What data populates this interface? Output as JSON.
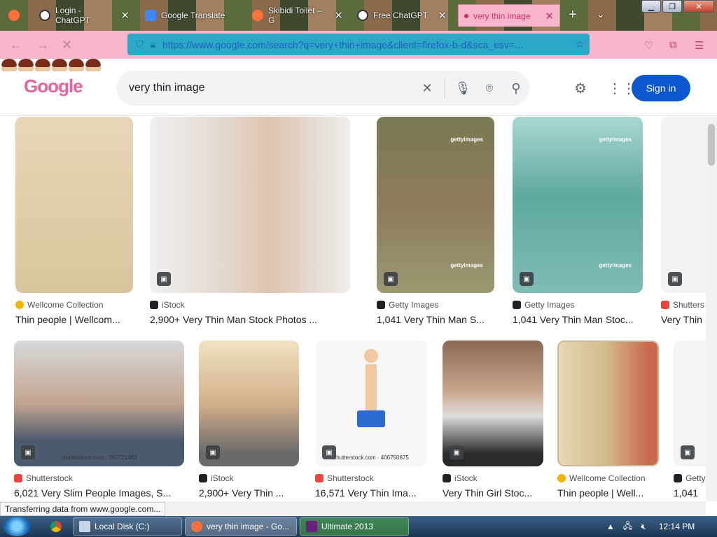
{
  "browser": {
    "tabs": [
      {
        "label": "Login - ChatGPT",
        "fav_color": "#ffffff"
      },
      {
        "label": "Google Translate",
        "fav_color": "#4285f4"
      },
      {
        "label": "Skibidi Toilet – G",
        "fav_color": "#ff7139"
      },
      {
        "label": "Free ChatGPT",
        "fav_color": "#ffffff"
      },
      {
        "label": "very thin image",
        "fav_color": "#d0305a"
      }
    ],
    "new_tab_symbol": "+",
    "url": "https://www.google.com/search?q=very+thin+image&client=firefox-b-d&sca_esv=..."
  },
  "google": {
    "logo_text": "Google",
    "query": "very thin image",
    "signin_label": "Sign in"
  },
  "results": {
    "row1": [
      {
        "source": "Wellcome Collection",
        "title": "Thin people | Wellcom...",
        "fav": "#f4b400"
      },
      {
        "source": "iStock",
        "title": "2,900+ Very Thin Man Stock Photos ...",
        "fav": "#202124"
      },
      {
        "source": "Getty Images",
        "title": "1,041 Very Thin Man S...",
        "fav": "#202124",
        "watermark": "gettyimages"
      },
      {
        "source": "Getty Images",
        "title": "1,041 Very Thin Man Stoc...",
        "fav": "#202124",
        "watermark": "gettyimages"
      },
      {
        "source": "Shutters",
        "title": "Very Thin",
        "fav": "#e8453c"
      }
    ],
    "row2": [
      {
        "source": "Shutterstock",
        "title": "6,021 Very Slim People Images, S...",
        "fav": "#e8453c",
        "watermark": "shutterstock.com · 367721483"
      },
      {
        "source": "iStock",
        "title": "2,900+ Very Thin ...",
        "fav": "#202124"
      },
      {
        "source": "Shutterstock",
        "title": "16,571 Very Thin Ima...",
        "fav": "#e8453c",
        "watermark": "shutterstock.com · 406750675"
      },
      {
        "source": "iStock",
        "title": "Very Thin Girl Stoc...",
        "fav": "#202124"
      },
      {
        "source": "Wellcome Collection",
        "title": "Thin people | Well...",
        "fav": "#f4b400"
      },
      {
        "source": "Getty",
        "title": "1,041",
        "fav": "#202124"
      }
    ]
  },
  "status_text": "Transferring data from www.google.com...",
  "taskbar": {
    "items": [
      {
        "label": "Local Disk (C:)"
      },
      {
        "label": "very thin image - Go..."
      },
      {
        "label": "Ultimate 2013"
      }
    ],
    "clock": "12:14 PM"
  }
}
